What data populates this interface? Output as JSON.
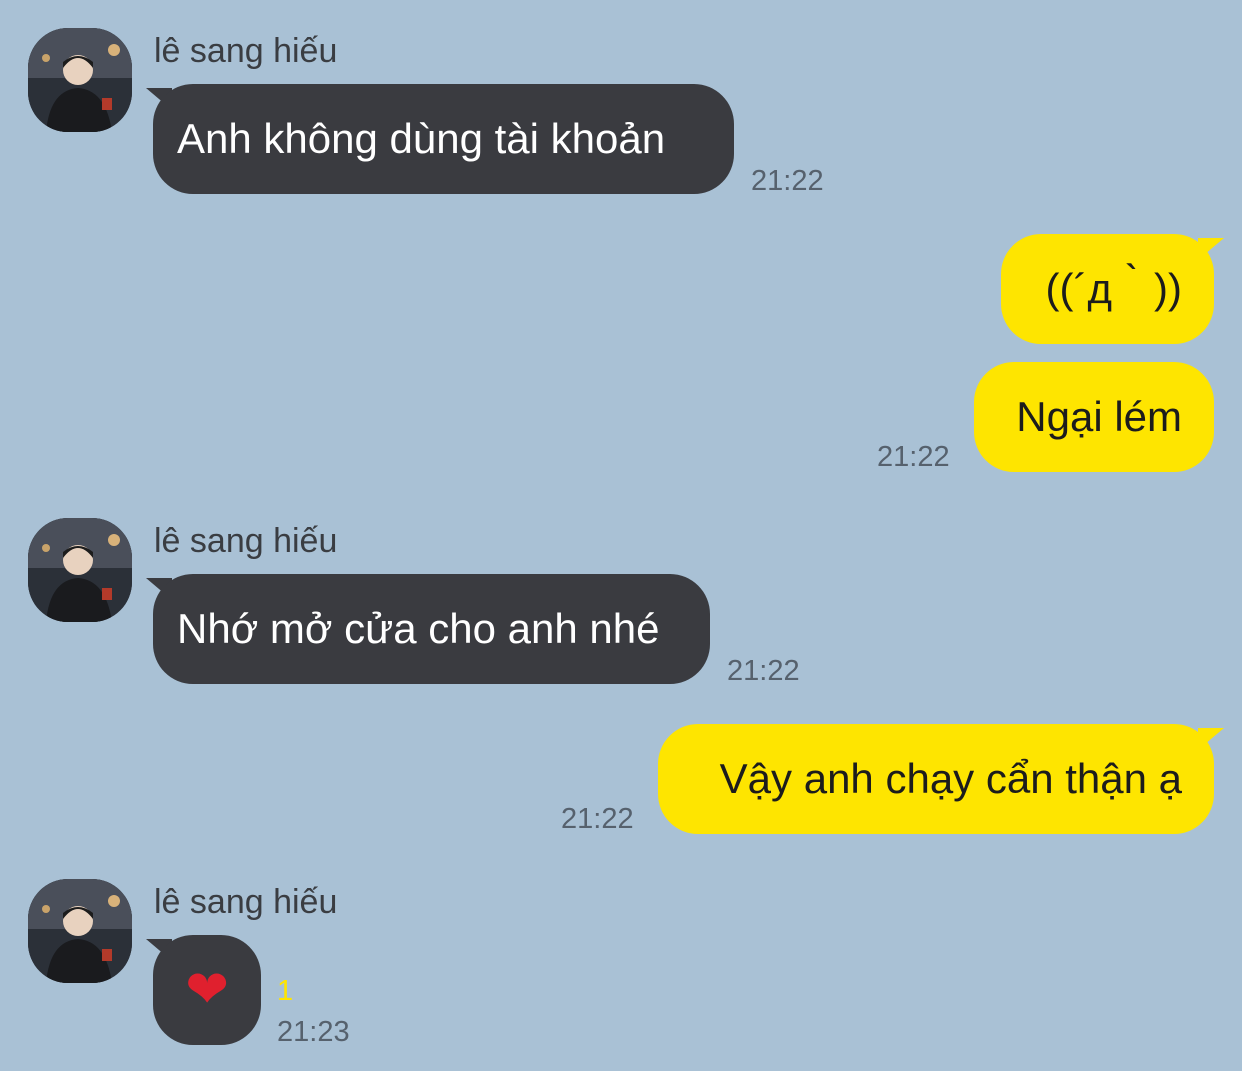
{
  "chat": {
    "sender_name": "lê sang hiếu",
    "messages": [
      {
        "side": "in",
        "text": "Anh không dùng tài khoản",
        "time": "21:22"
      },
      {
        "side": "out",
        "text": "((´д｀))"
      },
      {
        "side": "out",
        "text": "Ngại lém",
        "time": "21:22"
      },
      {
        "side": "in",
        "text": "Nhớ mở cửa cho anh nhé",
        "time": "21:22"
      },
      {
        "side": "out",
        "text": "Vậy anh chạy cẩn thận ạ",
        "time": "21:22"
      },
      {
        "side": "in",
        "text": "❤",
        "time": "21:23",
        "unread_count": "1"
      }
    ]
  },
  "colors": {
    "background": "#A9C1D5",
    "incoming_bubble": "#3A3B40",
    "outgoing_bubble": "#FEE500",
    "unread": "#FEE500"
  },
  "icons": {
    "avatar": "profile-photo",
    "heart": "red-heart-emoji"
  }
}
